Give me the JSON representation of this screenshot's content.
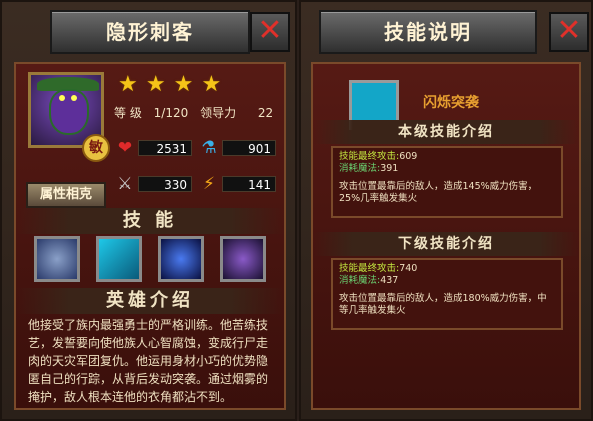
{
  "left": {
    "title": "隐形刺客",
    "close_label": "✕",
    "stars": [
      "★",
      "★",
      "★",
      "★"
    ],
    "level_label": "等 级",
    "level_value": "1/120",
    "leadership_label": "领导力",
    "leadership_value": "22",
    "hp": "2531",
    "mana": "901",
    "attack": "330",
    "speed": "141",
    "badge": "敏",
    "attr_button": "属性相克",
    "skills_title": "技 能",
    "hero_intro_title": "英雄介绍",
    "hero_intro_text": "他接受了族内最强勇士的严格训练。他苦练技艺，发誓要向使他族人心智腐蚀，变成行尸走肉的天灾军团复仇。他运用身材小巧的优势隐匿自己的行踪，从背后发动突袭。通过烟雾的掩护，敌人根本连他的衣角都沾不到。",
    "skill_icons": [
      "storm-cloud-icon",
      "dash-icon",
      "crescent-icon",
      "beast-icon"
    ]
  },
  "right": {
    "title": "技能说明",
    "close_label": "✕",
    "skill_name": "闪烁突袭",
    "current_title": "本级技能介绍",
    "current_attack_label": "技能最终攻击:",
    "current_attack": "609",
    "current_mana_label": "消耗魔法:",
    "current_mana": "391",
    "current_desc": "攻击位置最靠后的敌人，造成145%威力伤害，25%几率触发集火",
    "next_title": "下级技能介绍",
    "next_attack_label": "技能最终攻击:",
    "next_attack": "740",
    "next_mana_label": "消耗魔法:",
    "next_mana": "437",
    "next_desc": "攻击位置最靠后的敌人，造成180%威力伤害，中等几率触发集火"
  }
}
